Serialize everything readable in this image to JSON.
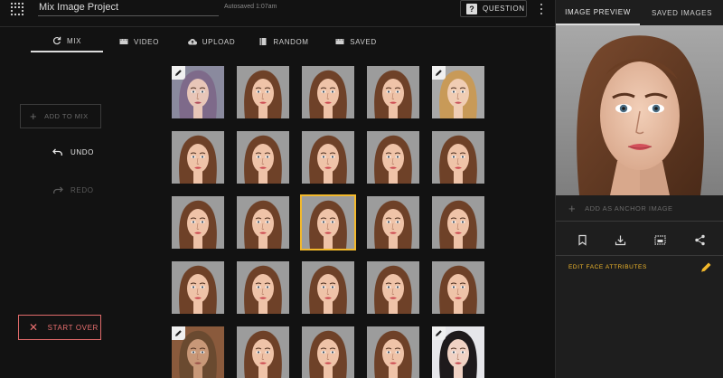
{
  "header": {
    "project_name": "Mix Image Project",
    "autosaved": "Autosaved 1:07am",
    "question_label": "QUESTION"
  },
  "tabs": [
    {
      "label": "MIX",
      "icon": "refresh-icon",
      "active": true
    },
    {
      "label": "VIDEO",
      "icon": "film-icon",
      "active": false
    },
    {
      "label": "UPLOAD",
      "icon": "cloud-upload-icon",
      "active": false
    },
    {
      "label": "RANDOM",
      "icon": "book-icon",
      "active": false
    },
    {
      "label": "SAVED",
      "icon": "film-icon",
      "active": false
    }
  ],
  "left": {
    "add_to_mix": "ADD TO MIX",
    "undo": "UNDO",
    "redo": "REDO",
    "start_over": "START OVER"
  },
  "grid": {
    "rows": 5,
    "cols": 5,
    "selected": [
      2,
      2
    ],
    "edit_badges": [
      [
        0,
        0
      ],
      [
        0,
        4
      ],
      [
        4,
        0
      ],
      [
        4,
        4
      ]
    ],
    "variants": [
      [
        "purple-hair",
        "auburn",
        "auburn",
        "auburn",
        "blonde"
      ],
      [
        "auburn",
        "auburn",
        "auburn",
        "auburn",
        "auburn"
      ],
      [
        "auburn",
        "auburn",
        "auburn",
        "auburn",
        "auburn"
      ],
      [
        "auburn",
        "auburn",
        "auburn",
        "auburn",
        "auburn"
      ],
      [
        "elderly",
        "auburn",
        "auburn",
        "auburn",
        "black-hair"
      ]
    ]
  },
  "right_panel": {
    "tabs": [
      "IMAGE PREVIEW",
      "SAVED IMAGES"
    ],
    "active_tab": "IMAGE PREVIEW",
    "add_anchor": "ADD AS ANCHOR IMAGE",
    "actions": [
      "bookmark-icon",
      "download-icon",
      "image-frame-icon",
      "share-icon"
    ],
    "edit_face": "EDIT FACE ATTRIBUTES"
  },
  "colors": {
    "accent": "#f2b82b",
    "danger": "#e06a6a",
    "background": "#121212",
    "panel": "#1e1e1e"
  }
}
